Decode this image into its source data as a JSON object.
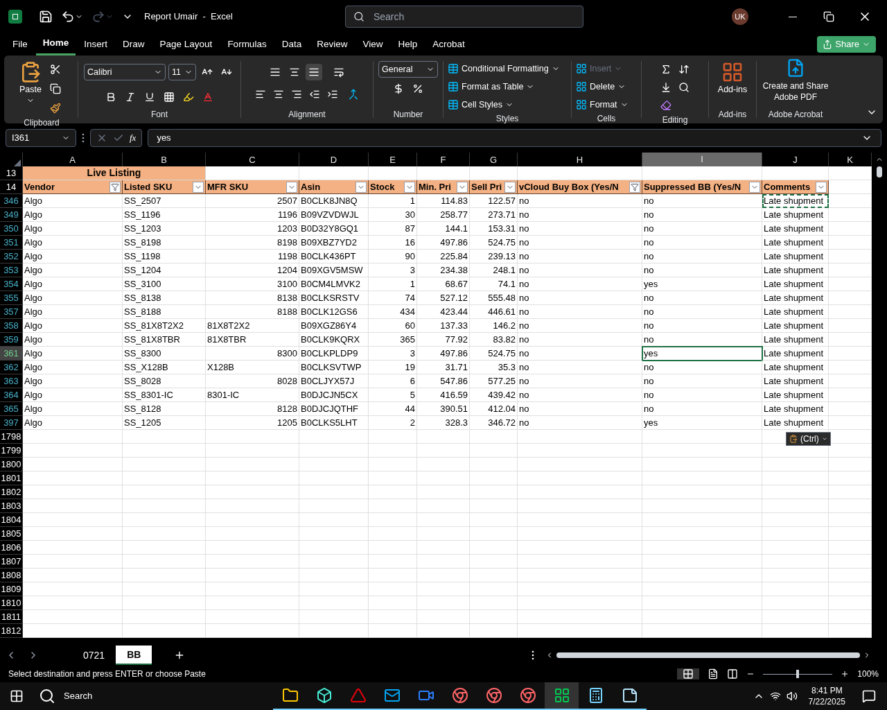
{
  "title_bar": {
    "title": "Report Umair  -  Excel",
    "search_placeholder": "Search",
    "avatar": "UK"
  },
  "menu_tabs": [
    {
      "label": "File",
      "selected": false
    },
    {
      "label": "Home",
      "selected": true
    },
    {
      "label": "Insert",
      "selected": false
    },
    {
      "label": "Draw",
      "selected": false
    },
    {
      "label": "Page Layout",
      "selected": false
    },
    {
      "label": "Formulas",
      "selected": false
    },
    {
      "label": "Data",
      "selected": false
    },
    {
      "label": "Review",
      "selected": false
    },
    {
      "label": "View",
      "selected": false
    },
    {
      "label": "Help",
      "selected": false
    },
    {
      "label": "Acrobat",
      "selected": false
    }
  ],
  "share": "Share",
  "ribbon": {
    "clipboard": {
      "paste": "Paste",
      "label": "Clipboard"
    },
    "font": {
      "family": "Calibri",
      "size": "11",
      "label": "Font"
    },
    "alignment": {
      "label": "Alignment"
    },
    "number": {
      "format": "General",
      "label": "Number"
    },
    "styles": {
      "items": [
        "Conditional Formatting",
        "Format as Table",
        "Cell Styles"
      ],
      "label": "Styles"
    },
    "cells": {
      "items": [
        {
          "label": "Insert",
          "disabled": true
        },
        {
          "label": "Delete",
          "disabled": false
        },
        {
          "label": "Format",
          "disabled": false
        }
      ],
      "label": "Cells"
    },
    "editing": {
      "label": "Editing"
    },
    "addins": {
      "button": "Add-ins",
      "label": "Add-ins"
    },
    "acrobat": {
      "button": "Create and Share Adobe PDF",
      "label": "Adobe Acrobat"
    }
  },
  "formula_bar": {
    "name_box": "I361",
    "function_label": "fx",
    "value": "yes"
  },
  "sheet": {
    "columns": [
      {
        "letter": "A",
        "selected": false
      },
      {
        "letter": "B",
        "selected": false
      },
      {
        "letter": "C",
        "selected": false
      },
      {
        "letter": "D",
        "selected": false
      },
      {
        "letter": "E",
        "selected": false
      },
      {
        "letter": "F",
        "selected": false
      },
      {
        "letter": "G",
        "selected": false
      },
      {
        "letter": "H",
        "selected": false
      },
      {
        "letter": "I",
        "selected": true
      },
      {
        "letter": "J",
        "selected": false
      },
      {
        "letter": "K",
        "selected": false
      }
    ],
    "title_row": "13",
    "title": "Live Listing",
    "header_row": "14",
    "headers": [
      {
        "label": "Vendor",
        "filtered": true
      },
      {
        "label": "Listed SKU",
        "filtered": false
      },
      {
        "label": "MFR SKU",
        "filtered": false
      },
      {
        "label": "Asin",
        "filtered": false
      },
      {
        "label": "Stock",
        "filtered": false
      },
      {
        "label": "Min. Pri",
        "filtered": false
      },
      {
        "label": "Sell Pri",
        "filtered": false
      },
      {
        "label": "vCloud Buy Box (Yes/N",
        "filtered": true
      },
      {
        "label": "Suppressed BB (Yes/N",
        "filtered": false
      },
      {
        "label": "Comments",
        "filtered": false
      }
    ],
    "rows": [
      {
        "number": "346",
        "selected": false,
        "copied": true,
        "cells": [
          "Algo",
          "SS_2507",
          "2507",
          "B0CLK8JN8Q",
          "1",
          "114.83",
          "122.57",
          "no",
          "no",
          "Late shupment"
        ]
      },
      {
        "number": "349",
        "selected": false,
        "copied": false,
        "cells": [
          "Algo",
          "SS_1196",
          "1196",
          "B09VZVDWJL",
          "30",
          "258.77",
          "273.71",
          "no",
          "no",
          "Late shupment"
        ]
      },
      {
        "number": "350",
        "selected": false,
        "copied": false,
        "cells": [
          "Algo",
          "SS_1203",
          "1203",
          "B0D32Y8GQ1",
          "87",
          "144.1",
          "153.31",
          "no",
          "no",
          "Late shupment"
        ]
      },
      {
        "number": "351",
        "selected": false,
        "copied": false,
        "cells": [
          "Algo",
          "SS_8198",
          "8198",
          "B09XBZ7YD2",
          "16",
          "497.86",
          "524.75",
          "no",
          "no",
          "Late shupment"
        ]
      },
      {
        "number": "352",
        "selected": false,
        "copied": false,
        "cells": [
          "Algo",
          "SS_1198",
          "1198",
          "B0CLK436PT",
          "90",
          "225.84",
          "239.13",
          "no",
          "no",
          "Late shupment"
        ]
      },
      {
        "number": "353",
        "selected": false,
        "copied": false,
        "cells": [
          "Algo",
          "SS_1204",
          "1204",
          "B09XGV5MSW",
          "3",
          "234.38",
          "248.1",
          "no",
          "no",
          "Late shupment"
        ]
      },
      {
        "number": "354",
        "selected": false,
        "copied": false,
        "cells": [
          "Algo",
          "SS_3100",
          "3100",
          "B0CM4LMVK2",
          "1",
          "68.67",
          "74.1",
          "no",
          "yes",
          "Late shupment"
        ]
      },
      {
        "number": "355",
        "selected": false,
        "copied": false,
        "cells": [
          "Algo",
          "SS_8138",
          "8138",
          "B0CLKSRSTV",
          "74",
          "527.12",
          "555.48",
          "no",
          "no",
          "Late shupment"
        ]
      },
      {
        "number": "357",
        "selected": false,
        "copied": false,
        "cells": [
          "Algo",
          "SS_8188",
          "8188",
          "B0CLK12GS6",
          "434",
          "423.44",
          "446.61",
          "no",
          "no",
          "Late shupment"
        ]
      },
      {
        "number": "358",
        "selected": false,
        "copied": false,
        "cells": [
          "Algo",
          "SS_81X8T2X2",
          "81X8T2X2",
          "B09XGZ86Y4",
          "60",
          "137.33",
          "146.2",
          "no",
          "no",
          "Late shupment"
        ]
      },
      {
        "number": "359",
        "selected": false,
        "copied": false,
        "cells": [
          "Algo",
          "SS_81X8TBR",
          "81X8TBR",
          "B0CLK9KQRX",
          "365",
          "77.92",
          "83.82",
          "no",
          "no",
          "Late shupment"
        ]
      },
      {
        "number": "361",
        "selected": true,
        "copied": false,
        "cells": [
          "Algo",
          "SS_8300",
          "8300",
          "B0CLKPLDP9",
          "3",
          "497.86",
          "524.75",
          "no",
          "yes",
          "Late shupment"
        ]
      },
      {
        "number": "362",
        "selected": false,
        "copied": false,
        "cells": [
          "Algo",
          "SS_X128B",
          "X128B",
          "B0CLKSVTWP",
          "19",
          "31.71",
          "35.3",
          "no",
          "no",
          "Late shupment"
        ]
      },
      {
        "number": "363",
        "selected": false,
        "copied": false,
        "cells": [
          "Algo",
          "SS_8028",
          "8028",
          "B0CLJYX57J",
          "6",
          "547.86",
          "577.25",
          "no",
          "no",
          "Late shupment"
        ]
      },
      {
        "number": "364",
        "selected": false,
        "copied": false,
        "cells": [
          "Algo",
          "SS_8301-IC",
          "8301-IC",
          "B0DJCJN5CX",
          "5",
          "416.59",
          "439.42",
          "no",
          "no",
          "Late shupment"
        ]
      },
      {
        "number": "365",
        "selected": false,
        "copied": false,
        "cells": [
          "Algo",
          "SS_8128",
          "8128",
          "B0DJCJQTHF",
          "44",
          "390.51",
          "412.04",
          "no",
          "no",
          "Late shupment"
        ]
      },
      {
        "number": "397",
        "selected": false,
        "copied": false,
        "cells": [
          "Algo",
          "SS_1205",
          "1205",
          "B0CLKS5LHT",
          "2",
          "328.3",
          "346.72",
          "no",
          "yes",
          "Late shupment"
        ]
      }
    ],
    "empty_rows": [
      "1798",
      "1799",
      "1800",
      "1801",
      "1802",
      "1803",
      "1804",
      "1805",
      "1806",
      "1807",
      "1808",
      "1809",
      "1810",
      "1811",
      "1812"
    ],
    "paste_options": "(Ctrl)"
  },
  "sheet_tabs": [
    {
      "label": "0721",
      "selected": false
    },
    {
      "label": "BB",
      "selected": true
    }
  ],
  "status_bar": {
    "message": "Select destination and press ENTER or choose Paste",
    "zoom": "100%",
    "zoom_slider": {
      "level": 0.5
    }
  },
  "taskbar": {
    "search": "Search",
    "time": "8:41 PM",
    "date": "7/22/2025",
    "apps": [
      {
        "kind": "folder",
        "active": false
      },
      {
        "kind": "cube",
        "active": false
      },
      {
        "kind": "filezilla",
        "active": false
      },
      {
        "kind": "outlook",
        "active": false
      },
      {
        "kind": "zoom",
        "active": false
      },
      {
        "kind": "chrome",
        "active": false
      },
      {
        "kind": "chrome",
        "active": false
      },
      {
        "kind": "chrome",
        "active": false
      },
      {
        "kind": "excel",
        "active": true
      },
      {
        "kind": "calculator",
        "active": false
      },
      {
        "kind": "notes",
        "active": false
      }
    ]
  }
}
